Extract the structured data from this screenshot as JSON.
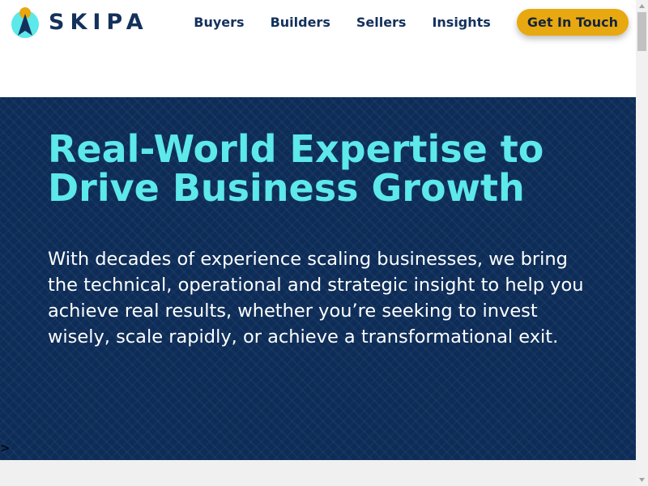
{
  "brand": {
    "name": "SKIPA",
    "colors": {
      "navy": "#14315c",
      "cyan": "#5de8ea",
      "gold": "#e8a80f",
      "hero_bg": "#0d2d58"
    }
  },
  "nav": {
    "items": [
      {
        "label": "Buyers"
      },
      {
        "label": "Builders"
      },
      {
        "label": "Sellers"
      },
      {
        "label": "Insights"
      }
    ],
    "cta_label": "Get In Touch"
  },
  "hero": {
    "title": "Real-World Expertise to Drive Business Growth",
    "body": "With decades of experience scaling businesses, we bring the technical, operational and strategic insight to help you achieve real results, whether you’re seeking to invest wisely, scale rapidly, or achieve a transformational exit.",
    "stray_text": ">"
  },
  "icons": {
    "logo": "skipa-logo-icon",
    "scroll_up": "scroll-up-arrow-icon",
    "scroll_down": "scroll-down-arrow-icon"
  }
}
